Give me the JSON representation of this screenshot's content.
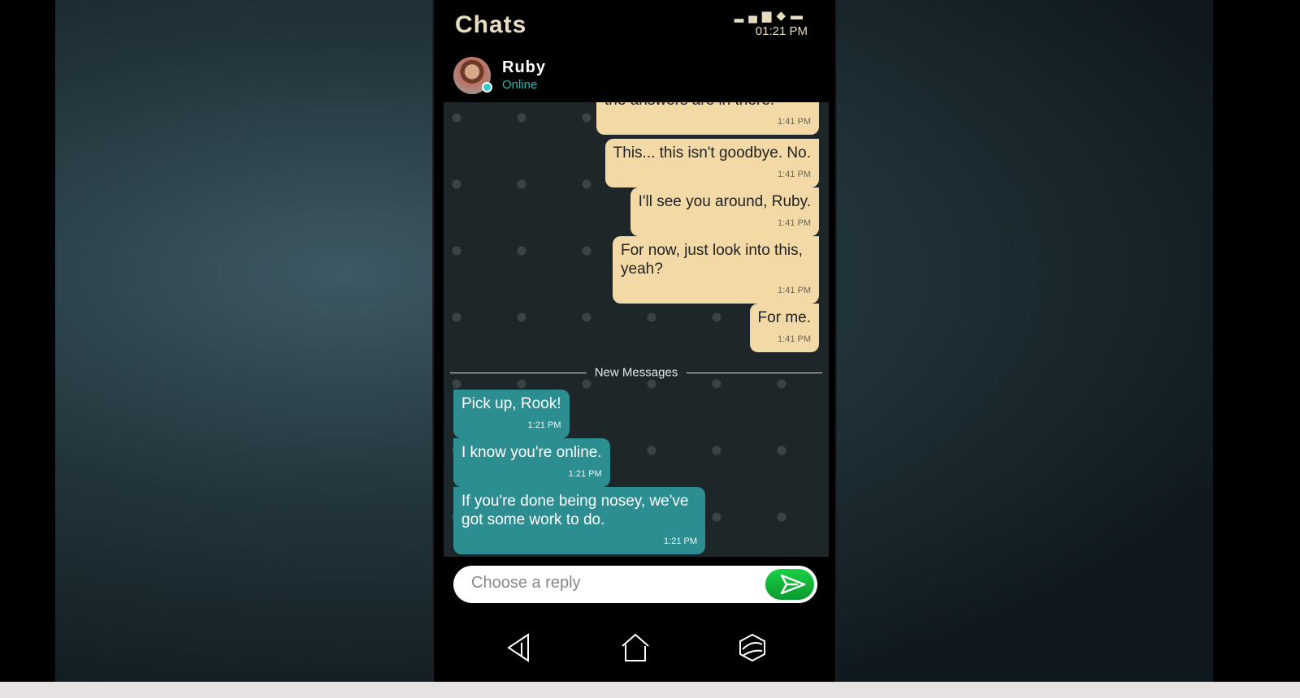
{
  "header": {
    "title": "Chats",
    "status_time": "01:21 PM",
    "status_icons": [
      "signal-icon",
      "wifi-icon",
      "battery-icon"
    ]
  },
  "contact": {
    "name": "Ruby",
    "status": "Online"
  },
  "messages_before": [
    {
      "text": "the answers are in there.",
      "time": "1:41 PM"
    },
    {
      "text": "This... this isn't goodbye. No.",
      "time": "1:41 PM"
    },
    {
      "text": "I'll see you around, Ruby.",
      "time": "1:41 PM"
    },
    {
      "text": "For now, just look into this, yeah?",
      "time": "1:41 PM"
    },
    {
      "text": "For me.",
      "time": "1:41 PM"
    }
  ],
  "divider_label": "New Messages",
  "messages_new": [
    {
      "text": "Pick up, Rook!",
      "time": "1:21 PM"
    },
    {
      "text": "I know you're online.",
      "time": "1:21 PM"
    },
    {
      "text": "If you're done being nosey, we've got some work to do.",
      "time": "1:21 PM"
    }
  ],
  "reply": {
    "placeholder": "Choose a reply"
  },
  "colors": {
    "outgoing": "#f3d9a5",
    "incoming": "#2d8e91",
    "send": "#12b83a",
    "online": "#2bb5b0"
  }
}
